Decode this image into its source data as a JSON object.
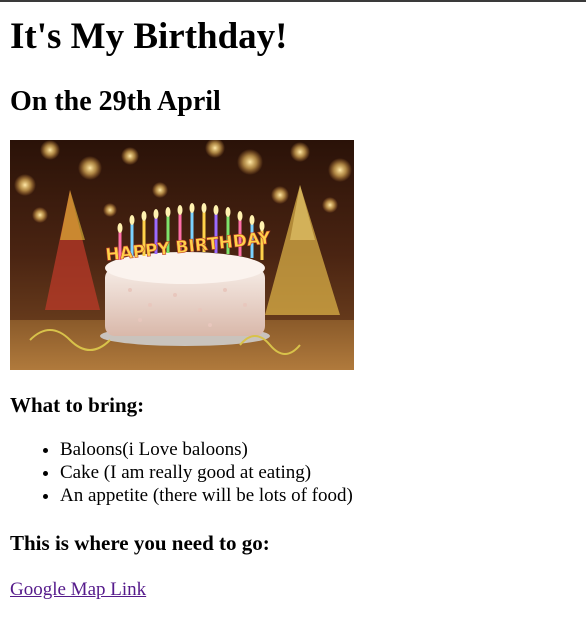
{
  "page": {
    "title": "It's My Birthday!",
    "date_heading": "On the 29th April",
    "image": {
      "description": "Birthday cake with candles",
      "candle_text": "HAPPY BIRTHDAY"
    },
    "bring_heading": "What to bring:",
    "bring_items": [
      "Baloons(i Love baloons)",
      "Cake (I am really good at eating)",
      "An appetite (there will be lots of food)"
    ],
    "location_heading": "This is where you need to go:",
    "map_link_text": "Google Map Link"
  },
  "colors": {
    "link_visited": "#551a8b",
    "text": "#000000",
    "background": "#ffffff"
  }
}
